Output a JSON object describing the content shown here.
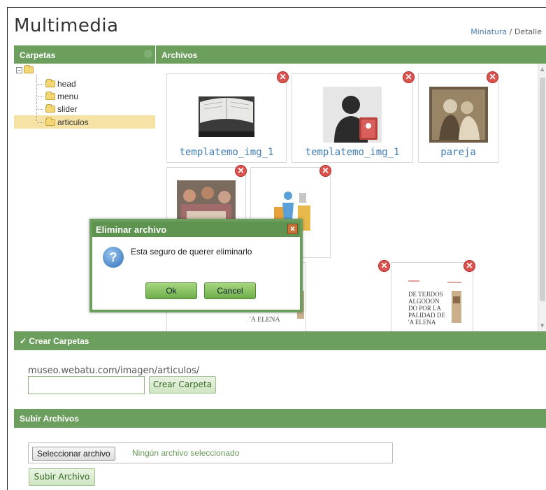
{
  "page": {
    "title": "Multimedia"
  },
  "view_mode": {
    "thumbnail": "Miniatura",
    "separator": " / ",
    "detail": "Detalle"
  },
  "panels": {
    "folders_title": "Carpetas",
    "files_title": "Archivos"
  },
  "tree": {
    "items": [
      "head",
      "menu",
      "slider",
      "articulos"
    ],
    "selected": "articulos"
  },
  "files": [
    {
      "name": "templatemo_img_1",
      "icon": "bible-photo"
    },
    {
      "name": "templatemo_img_1",
      "icon": "contact-silhouette"
    },
    {
      "name": "pareja",
      "icon": "sepia-couple-photo"
    },
    {
      "name": "",
      "icon": "group-photo"
    },
    {
      "name": "",
      "icon": "worker-boxes-illustration"
    },
    {
      "name": "",
      "icon": "book-cover",
      "partial_text": "'A ELENA"
    },
    {
      "name": "",
      "icon": "book-cover",
      "cover_text": "DE TEJIDOS\nALGODON\nDO POR LA\nPALIDAD DE\n'A ELENA"
    }
  ],
  "dialog": {
    "title": "Eliminar archivo",
    "message": "Esta seguro de querer eliminarlo",
    "ok_label": "Ok",
    "cancel_label": "Cancel",
    "close_glyph": "x"
  },
  "create_folder": {
    "title": "Crear Carpetas",
    "path": "museo.webatu.com/imagen/articulos/",
    "input_value": "",
    "button_label": "Crear Carpeta"
  },
  "upload": {
    "title": "Subir Archivos",
    "choose_label": "Seleccionar archivo",
    "status": "Ningún archivo seleccionado",
    "button_label": "Subir Archivo"
  },
  "colors": {
    "bar": "#6c9e5e",
    "link": "#3f7cb5",
    "delete": "#d9534f",
    "selected": "#f7e2a6"
  }
}
